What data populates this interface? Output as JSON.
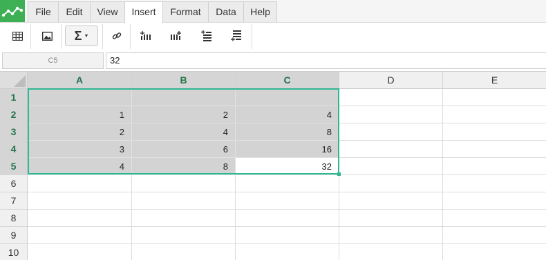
{
  "menu": {
    "tabs": [
      {
        "label": "File"
      },
      {
        "label": "Edit"
      },
      {
        "label": "View"
      },
      {
        "label": "Insert",
        "active": true
      },
      {
        "label": "Format"
      },
      {
        "label": "Data"
      },
      {
        "label": "Help"
      }
    ]
  },
  "toolbar": {
    "buttons": [
      {
        "icon": "table-icon"
      },
      {
        "icon": "image-icon"
      },
      {
        "icon": "sigma-icon",
        "label": "Σ"
      },
      {
        "icon": "link-icon"
      },
      {
        "icon": "insert-column-left-icon"
      },
      {
        "icon": "insert-column-right-icon"
      },
      {
        "icon": "insert-row-above-icon"
      },
      {
        "icon": "insert-row-below-icon"
      }
    ]
  },
  "formula_bar": {
    "cell_ref": "C5",
    "value": "32"
  },
  "sheet": {
    "columns": [
      "A",
      "B",
      "C",
      "D",
      "E"
    ],
    "rows": [
      "1",
      "2",
      "3",
      "4",
      "5",
      "6",
      "7",
      "8",
      "9",
      "10"
    ],
    "cells": {
      "A2": "1",
      "B2": "2",
      "C2": "4",
      "A3": "2",
      "B3": "4",
      "C3": "8",
      "A4": "3",
      "B4": "6",
      "C4": "16",
      "A5": "4",
      "B5": "8",
      "C5": "32"
    },
    "selection": "A1:C5",
    "active_cell": "C5"
  },
  "colors": {
    "accent": "#2fb792",
    "logo": "#3daf54",
    "header_selected_text": "#22744a",
    "selection_fill": "#d3d3d3"
  }
}
